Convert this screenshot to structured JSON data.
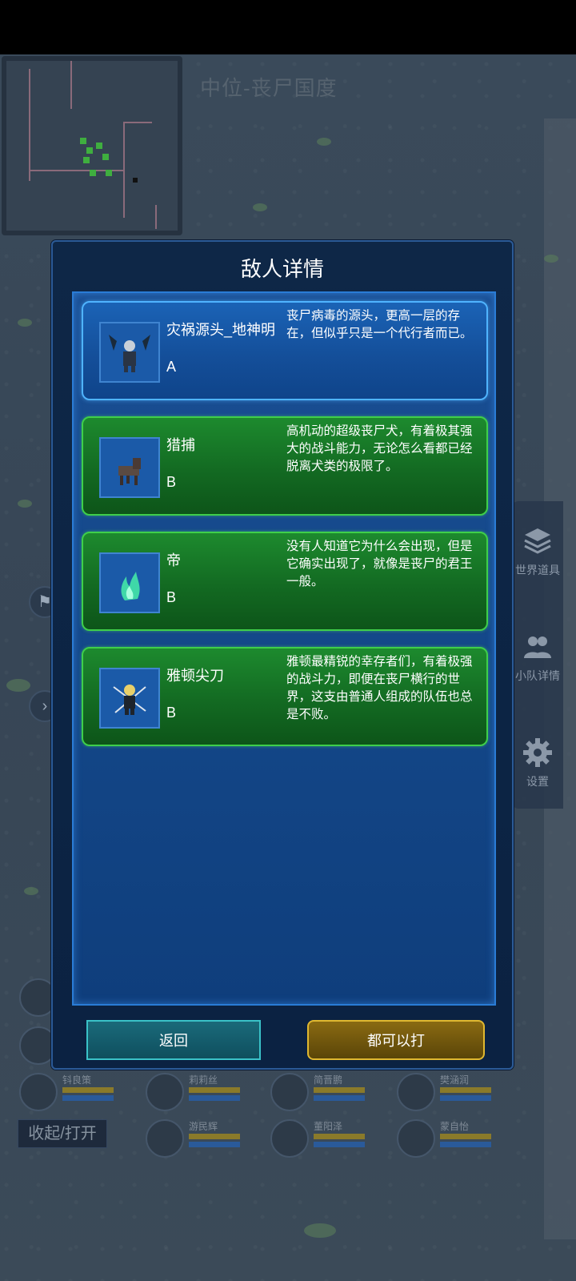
{
  "map": {
    "title": "中位-丧尸国度"
  },
  "side_menu": [
    {
      "label": "世界道具",
      "icon": "layers-icon"
    },
    {
      "label": "小队详情",
      "icon": "team-icon"
    },
    {
      "label": "设置",
      "icon": "gear-icon"
    }
  ],
  "dialog": {
    "title": "敌人详情",
    "enemies": [
      {
        "name": "灾祸源头_地神明",
        "rank": "A",
        "style": "blue",
        "desc": "丧尸病毒的源头，更高一层的存在，但似乎只是一个代行者而已。"
      },
      {
        "name": "猎捕",
        "rank": "B",
        "style": "green",
        "desc": "高机动的超级丧尸犬，有着极其强大的战斗能力，无论怎么看都已经脱离犬类的极限了。"
      },
      {
        "name": "帝",
        "rank": "B",
        "style": "green",
        "desc": "没有人知道它为什么会出现，但是它确实出现了，就像是丧尸的君王一般。"
      },
      {
        "name": "雅顿尖刀",
        "rank": "B",
        "style": "green",
        "desc": "雅顿最精锐的幸存者们，有着极强的战斗力，即便在丧尸横行的世界，这支由普通人组成的队伍也总是不败。"
      }
    ],
    "back_label": "返回",
    "fight_label": "都可以打"
  },
  "party": [
    {
      "name": "钭良策"
    },
    {
      "name": "莉莉丝"
    },
    {
      "name": "简晋鹏"
    },
    {
      "name": "樊涵润"
    },
    {
      "name": "游民辉"
    },
    {
      "name": "董阳泽"
    },
    {
      "name": "蒙自怡"
    }
  ],
  "toggle_label": "收起/打开",
  "colors": {
    "card_blue": "#1b63b6",
    "card_green": "#1d8a2e",
    "fight_gold": "#e0b830",
    "back_teal": "#3ac2c8"
  }
}
